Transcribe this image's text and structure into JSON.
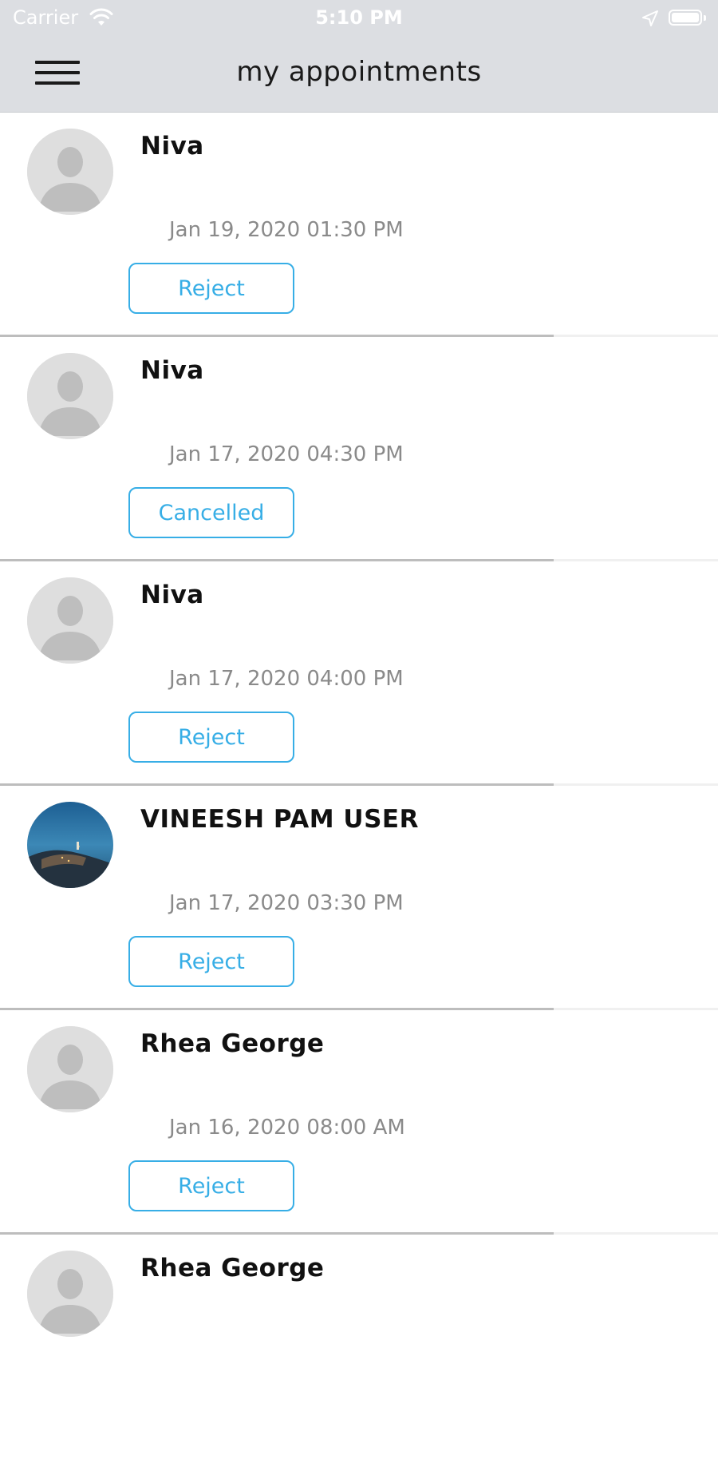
{
  "status_bar": {
    "carrier": "Carrier",
    "time": "5:10 PM",
    "icons": [
      "wifi-icon",
      "location-icon",
      "battery-icon"
    ]
  },
  "header": {
    "title": "my appointments",
    "menu_icon": "hamburger-menu-icon"
  },
  "colors": {
    "accent": "#37aee6",
    "nav_background": "#dcdee2"
  },
  "appointments": [
    {
      "name": "Niva",
      "datetime": "Jan 19, 2020 01:30 PM",
      "action": "Reject",
      "avatar": "placeholder-avatar"
    },
    {
      "name": "Niva",
      "datetime": "Jan 17, 2020 04:30 PM",
      "action": "Cancelled",
      "avatar": "placeholder-avatar"
    },
    {
      "name": "Niva",
      "datetime": "Jan 17, 2020 04:00 PM",
      "action": "Reject",
      "avatar": "placeholder-avatar"
    },
    {
      "name": "VINEESH PAM USER",
      "datetime": "Jan 17, 2020 03:30 PM",
      "action": "Reject",
      "avatar": "photo-avatar"
    },
    {
      "name": "Rhea George",
      "datetime": "Jan 16, 2020 08:00 AM",
      "action": "Reject",
      "avatar": "placeholder-avatar"
    },
    {
      "name": "Rhea George",
      "avatar": "placeholder-avatar"
    }
  ]
}
